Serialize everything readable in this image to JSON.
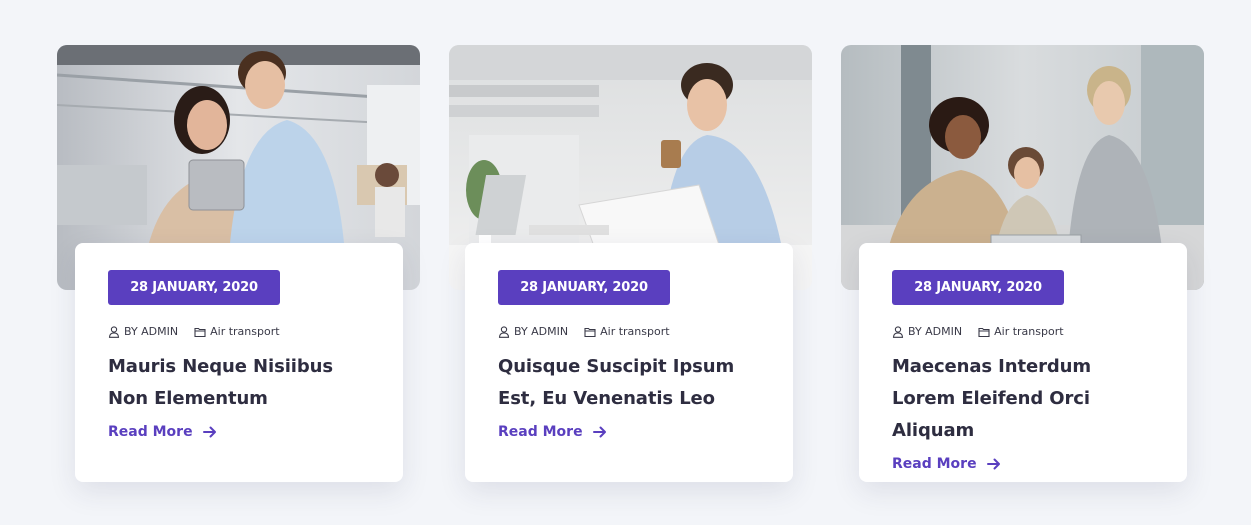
{
  "accent_color": "#5a3fbf",
  "cards": [
    {
      "date": "28 JANUARY, 2020",
      "author": "BY ADMIN",
      "category": "Air transport",
      "title": "Mauris Neque Nisiibus Non Elementum",
      "read_more": "Read More",
      "image_icon": "office-coworkers-tablet-photo"
    },
    {
      "date": "28 JANUARY, 2020",
      "author": "BY ADMIN",
      "category": "Air transport",
      "title": "Quisque Suscipit Ipsum Est, Eu Venenatis Leo",
      "read_more": "Read More",
      "image_icon": "businessman-coffee-documents-photo"
    },
    {
      "date": "28 JANUARY, 2020",
      "author": "BY ADMIN",
      "category": "Air transport",
      "title": "Maecenas Interdum Lorem Eleifend Orci Aliquam",
      "read_more": "Read More",
      "image_icon": "team-meeting-laptop-photo"
    }
  ]
}
